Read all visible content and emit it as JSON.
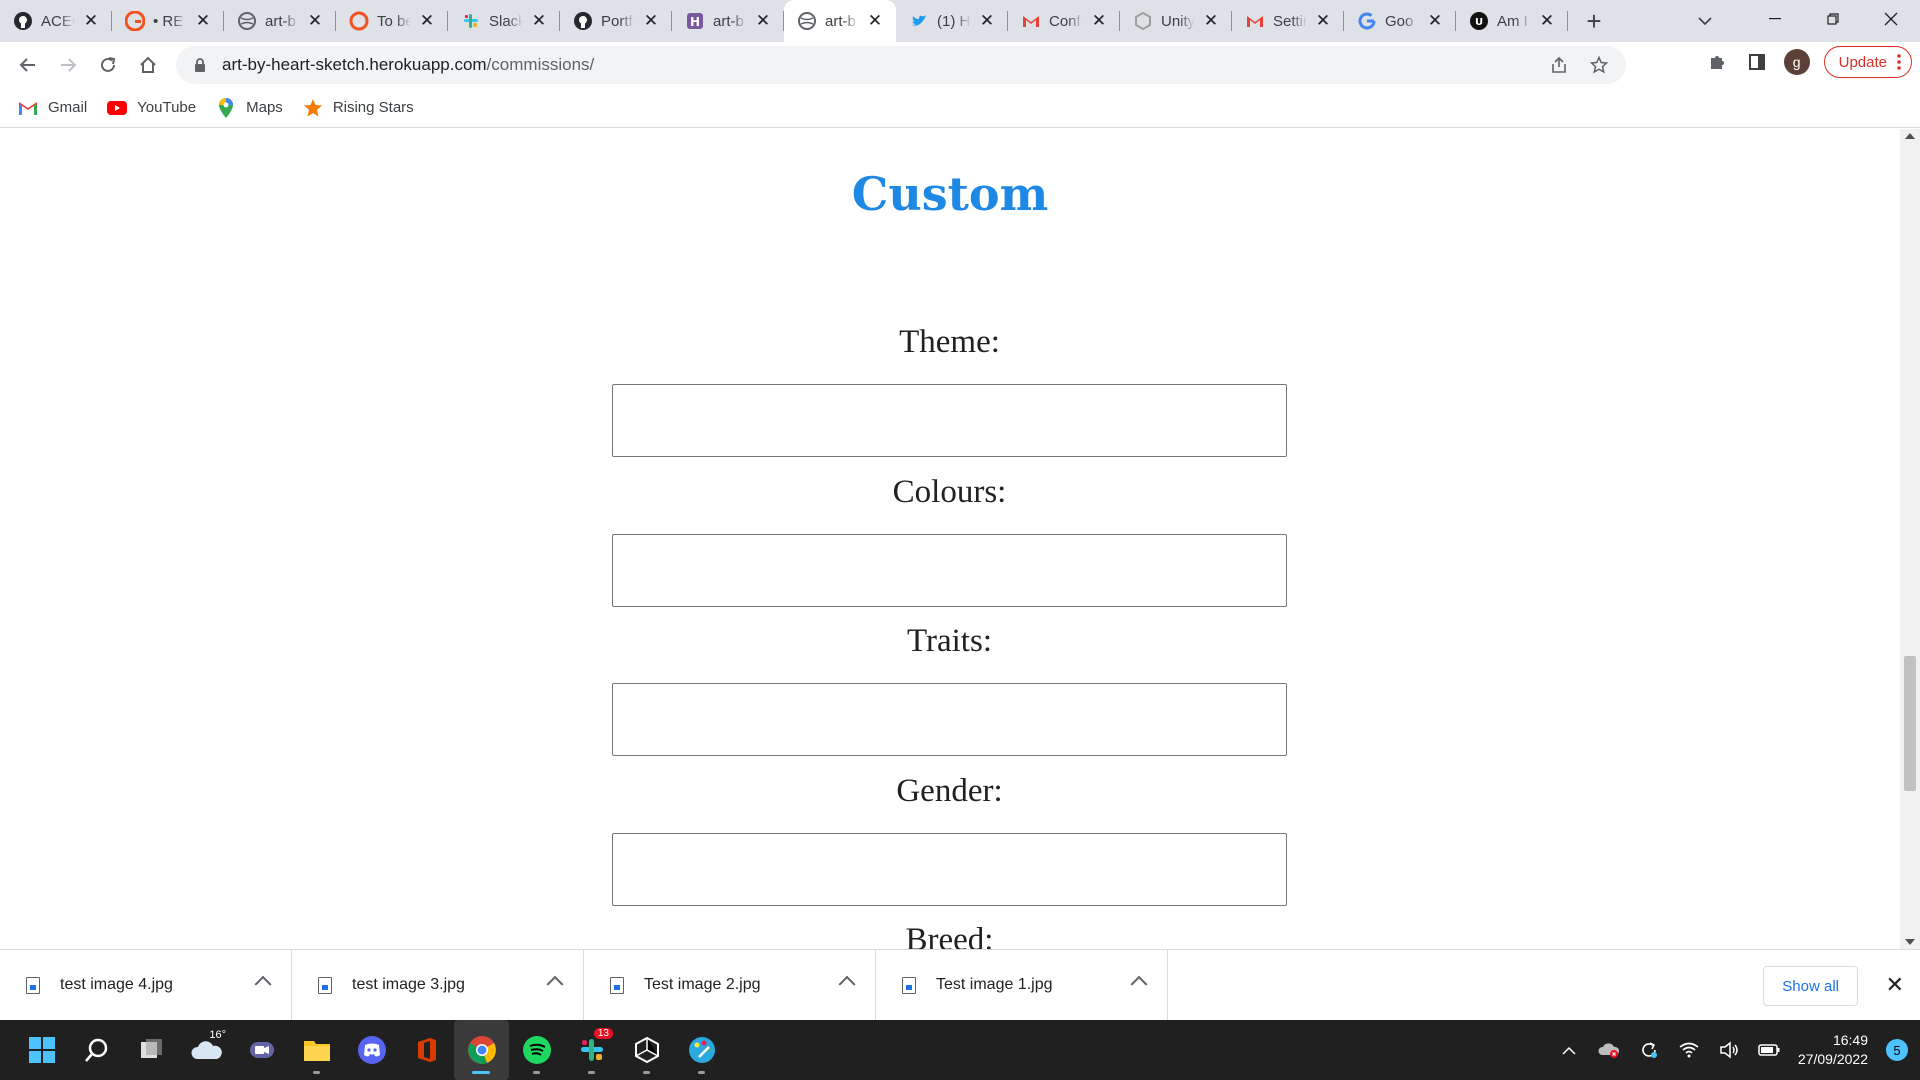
{
  "browser": {
    "tabs": [
      {
        "title": "ACEC",
        "icon": "github-icon",
        "active": false
      },
      {
        "title": "• RE",
        "icon": "grammarly-icon",
        "active": false
      },
      {
        "title": "art-b",
        "icon": "globe-icon",
        "active": false
      },
      {
        "title": "To be",
        "icon": "todo-icon",
        "active": false
      },
      {
        "title": "Slack",
        "icon": "slack-icon",
        "active": false
      },
      {
        "title": "Portf",
        "icon": "github-icon",
        "active": false
      },
      {
        "title": "art-b",
        "icon": "heroku-icon",
        "active": false
      },
      {
        "title": "art-b",
        "icon": "globe-icon",
        "active": true
      },
      {
        "title": "(1) H",
        "icon": "twitter-icon",
        "active": false
      },
      {
        "title": "Conf",
        "icon": "gmail-icon",
        "active": false
      },
      {
        "title": "Unity",
        "icon": "unity-icon",
        "active": false
      },
      {
        "title": "Settir",
        "icon": "gmail-icon",
        "active": false
      },
      {
        "title": "Goo",
        "icon": "google-icon",
        "active": false
      },
      {
        "title": "Am I",
        "icon": "uo-icon",
        "active": false
      }
    ],
    "url_host": "art-by-heart-sketch.herokuapp.com",
    "url_path": "/commissions/",
    "update_label": "Update",
    "profile_initial": "g",
    "bookmarks": [
      {
        "label": "Gmail",
        "icon": "gmail-icon"
      },
      {
        "label": "YouTube",
        "icon": "youtube-icon"
      },
      {
        "label": "Maps",
        "icon": "maps-icon"
      },
      {
        "label": "Rising Stars",
        "icon": "star-icon"
      }
    ]
  },
  "page": {
    "title": "Custom",
    "fields": [
      {
        "label": "Theme:",
        "value": ""
      },
      {
        "label": "Colours:",
        "value": ""
      },
      {
        "label": "Traits:",
        "value": ""
      },
      {
        "label": "Gender:",
        "value": ""
      },
      {
        "label": "Breed:",
        "value": ""
      }
    ]
  },
  "downloads": {
    "items": [
      "test image 4.jpg",
      "test image 3.jpg",
      "Test image 2.jpg",
      "Test image 1.jpg"
    ],
    "show_all_label": "Show all"
  },
  "taskbar": {
    "weather_temp": "16°",
    "slack_badge": "13",
    "time": "16:49",
    "date": "27/09/2022",
    "notification_count": "5"
  },
  "colors": {
    "title_blue": "#1e88e5",
    "update_red": "#d93025",
    "link_blue": "#1a73e8"
  }
}
